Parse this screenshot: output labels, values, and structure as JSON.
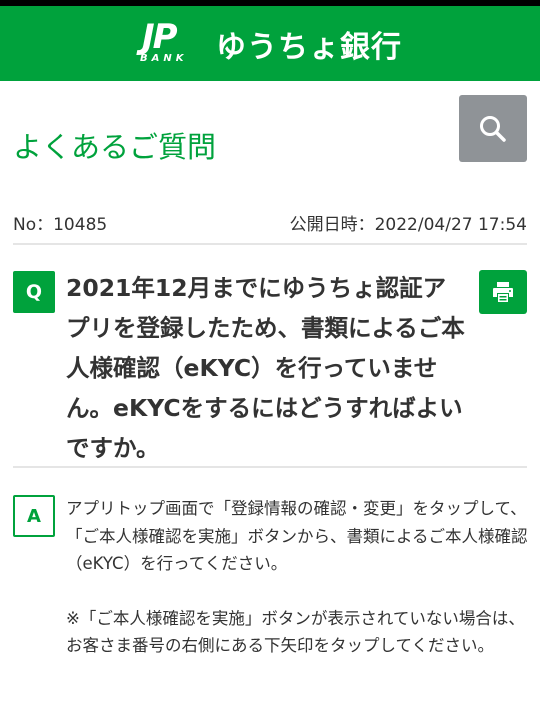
{
  "header": {
    "logo_mark": "JP",
    "logo_sub": "BANK",
    "bank_name": "ゆうちょ銀行"
  },
  "page": {
    "title": "よくあるご質問",
    "search_icon": "search-icon"
  },
  "meta": {
    "number_label": "No：10485",
    "published": "公開日時：2022/04/27 17:54"
  },
  "question": {
    "badge": "Q",
    "text": "2021年12月までにゆうちょ認証アプリを登録したため、書類によるご本人様確認（eKYC）を行っていません。eKYCをするにはどうすればよいですか。",
    "print_icon": "print-icon"
  },
  "answer": {
    "badge": "A",
    "paragraph1": "アプリトップ画面で「登録情報の確認・変更」をタップして、「ご本人様確認を実施」ボタンから、書類によるご本人様確認（eKYC）を行ってください。",
    "note": "※「ご本人様確認を実施」ボタンが表示されていない場合は、お客さま番号の右側にある下矢印をタップしてください。"
  },
  "colors": {
    "brand_green": "#00a23c",
    "search_gray": "#8f9397"
  }
}
